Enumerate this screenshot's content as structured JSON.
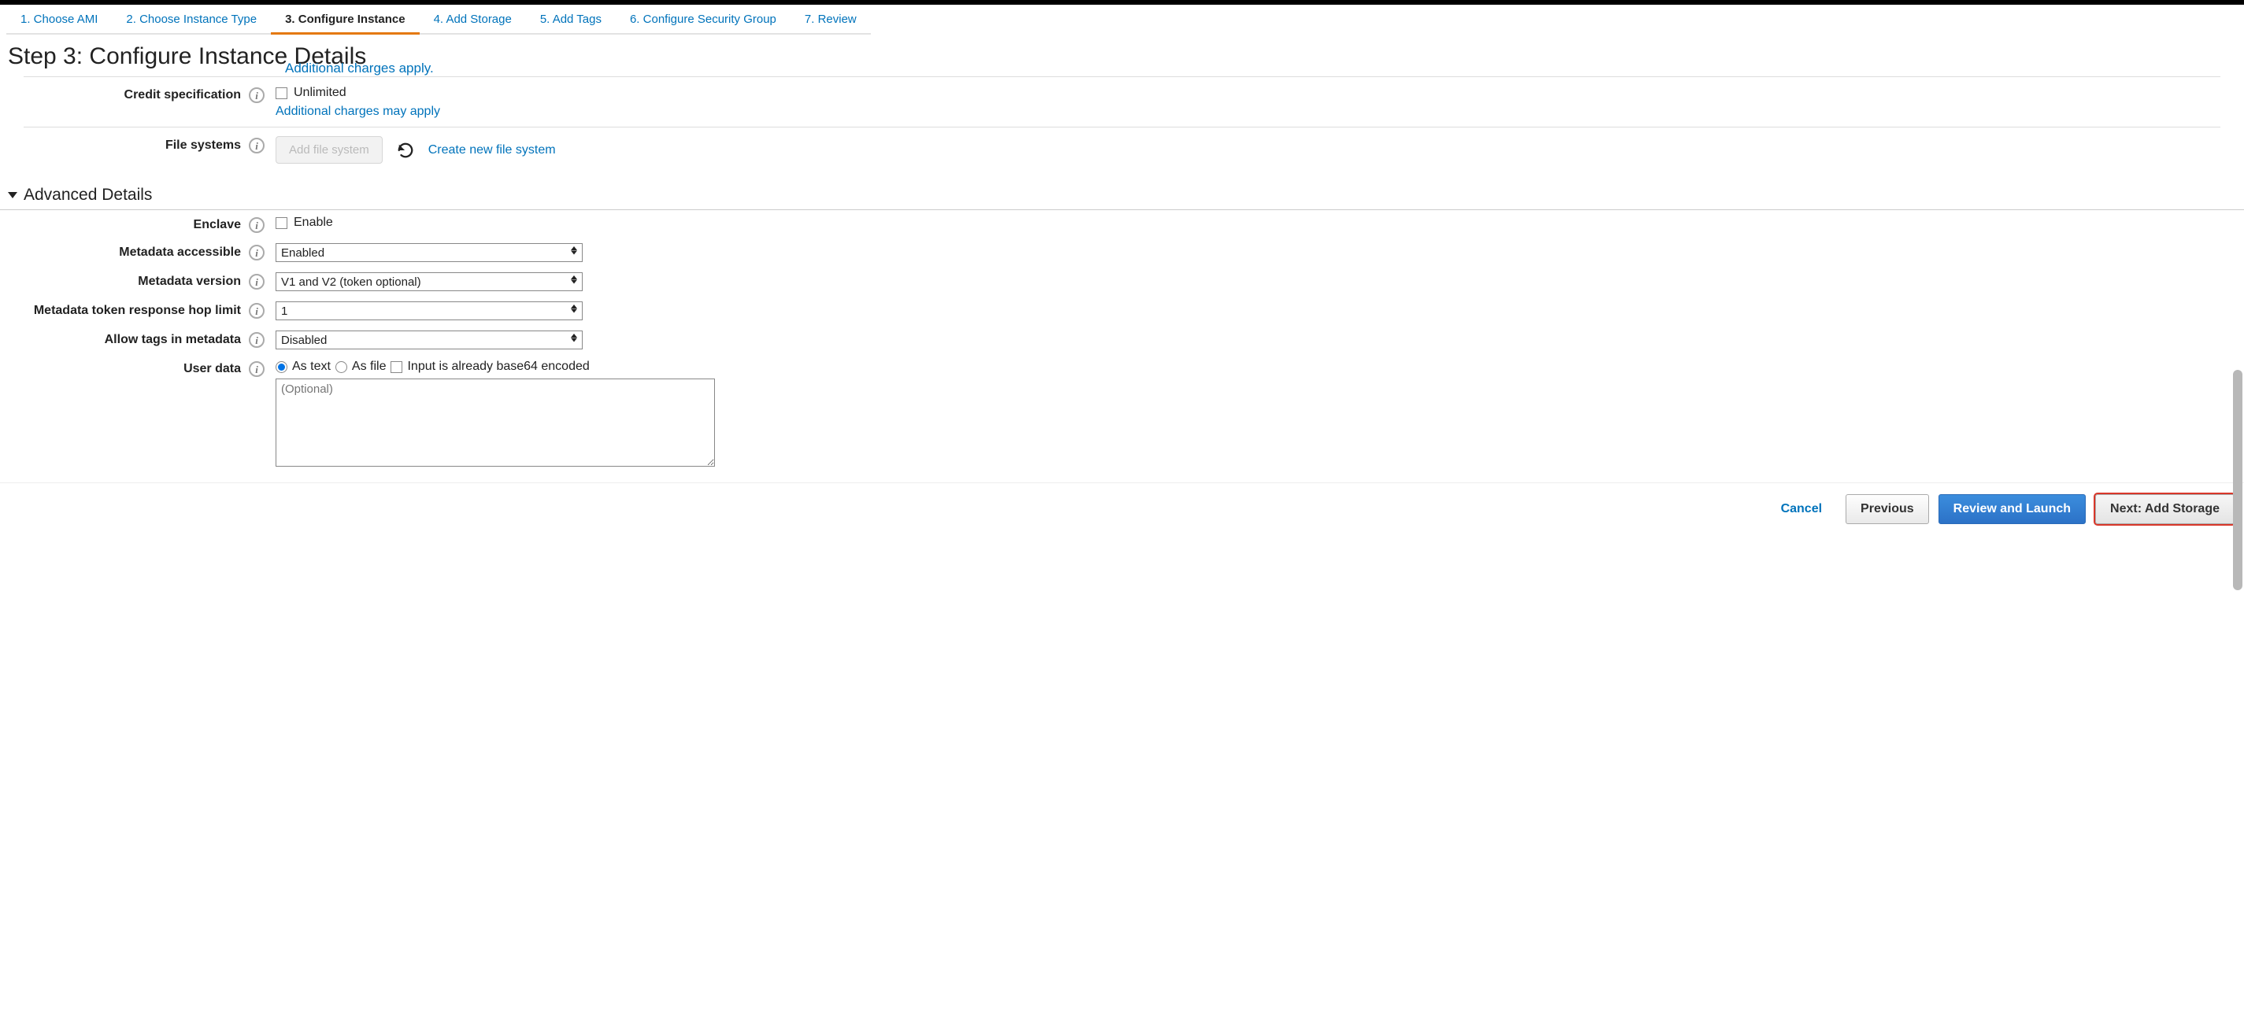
{
  "steps": [
    {
      "label": "1. Choose AMI"
    },
    {
      "label": "2. Choose Instance Type"
    },
    {
      "label": "3. Configure Instance"
    },
    {
      "label": "4. Add Storage"
    },
    {
      "label": "5. Add Tags"
    },
    {
      "label": "6. Configure Security Group"
    },
    {
      "label": "7. Review"
    }
  ],
  "heading": "Step 3: Configure Instance Details",
  "truncated_link": "Additional charges apply.",
  "credit_spec": {
    "label": "Credit specification",
    "checkbox_label": "Unlimited",
    "link": "Additional charges may apply"
  },
  "file_systems": {
    "label": "File systems",
    "button": "Add file system",
    "link": "Create new file system"
  },
  "advanced_header": "Advanced Details",
  "enclave": {
    "label": "Enclave",
    "checkbox_label": "Enable"
  },
  "metadata_accessible": {
    "label": "Metadata accessible",
    "value": "Enabled"
  },
  "metadata_version": {
    "label": "Metadata version",
    "value": "V1 and V2 (token optional)"
  },
  "metadata_hop": {
    "label": "Metadata token response hop limit",
    "value": "1"
  },
  "allow_tags": {
    "label": "Allow tags in metadata",
    "value": "Disabled"
  },
  "user_data": {
    "label": "User data",
    "opt_text": "As text",
    "opt_file": "As file",
    "opt_b64": "Input is already base64 encoded",
    "placeholder": "(Optional)"
  },
  "footer": {
    "cancel": "Cancel",
    "previous": "Previous",
    "review": "Review and Launch",
    "next": "Next: Add Storage"
  }
}
